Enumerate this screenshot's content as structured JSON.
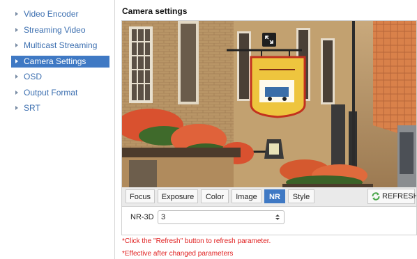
{
  "sidebar": {
    "items": [
      {
        "label": "Video Encoder",
        "active": false
      },
      {
        "label": "Streaming Video",
        "active": false
      },
      {
        "label": "Multicast Streaming",
        "active": false
      },
      {
        "label": "Camera Settings",
        "active": true
      },
      {
        "label": "OSD",
        "active": false
      },
      {
        "label": "Output Format",
        "active": false
      },
      {
        "label": "SRT",
        "active": false
      }
    ]
  },
  "main": {
    "title": "Camera settings",
    "video": {
      "fullscreen_icon": "fullscreen-icon"
    },
    "tabs": [
      {
        "label": "Focus",
        "active": false
      },
      {
        "label": "Exposure",
        "active": false
      },
      {
        "label": "Color",
        "active": false
      },
      {
        "label": "Image",
        "active": false
      },
      {
        "label": "NR",
        "active": true
      },
      {
        "label": "Style",
        "active": false
      }
    ],
    "refresh_label": "REFRESH",
    "nr3d": {
      "label": "NR-3D",
      "value": "3"
    },
    "notes": [
      "*Click the \"Refresh\" button to refresh parameter.",
      "*Effective after changed parameters"
    ]
  },
  "colors": {
    "accent": "#3f79c4",
    "link": "#3c6fb0",
    "note": "#e02020",
    "refresh_icon": "#4aa64a"
  }
}
